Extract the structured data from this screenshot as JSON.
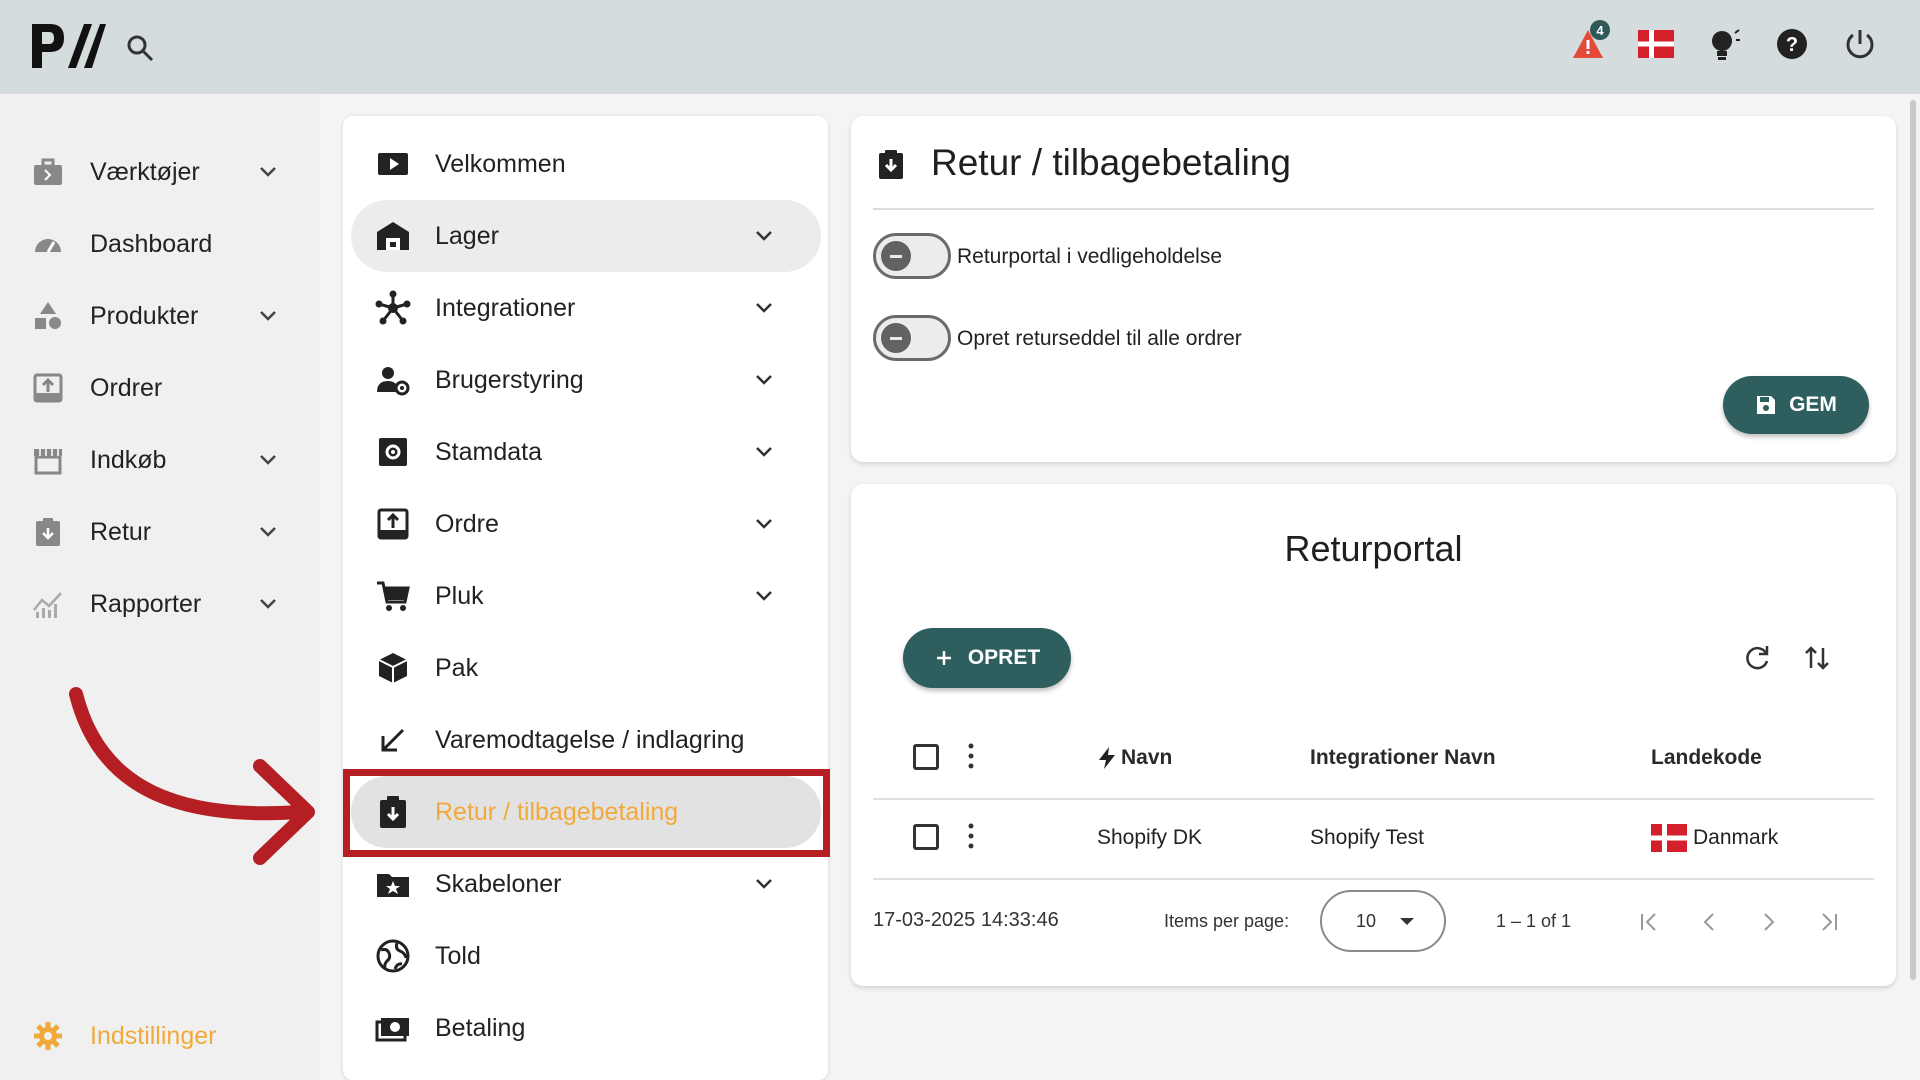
{
  "topbar": {
    "logo_text": "P//",
    "notification_count": "4",
    "icons": [
      "search-icon",
      "alert-icon",
      "denmark-flag-icon",
      "lightbulb-icon",
      "help-icon",
      "power-icon"
    ]
  },
  "sidebar": {
    "items": [
      {
        "label": "Værktøjer",
        "icon": "tools-icon",
        "expandable": true
      },
      {
        "label": "Dashboard",
        "icon": "dashboard-icon",
        "expandable": false
      },
      {
        "label": "Produkter",
        "icon": "products-icon",
        "expandable": true
      },
      {
        "label": "Ordrer",
        "icon": "orders-icon",
        "expandable": false
      },
      {
        "label": "Indkøb",
        "icon": "purchase-icon",
        "expandable": true
      },
      {
        "label": "Retur",
        "icon": "return-icon",
        "expandable": true
      },
      {
        "label": "Rapporter",
        "icon": "reports-icon",
        "expandable": true
      }
    ],
    "settings_label": "Indstillinger"
  },
  "settings_menu": {
    "items": [
      {
        "label": "Velkommen",
        "icon": "play-icon",
        "expandable": false
      },
      {
        "label": "Lager",
        "icon": "warehouse-icon",
        "expandable": true
      },
      {
        "label": "Integrationer",
        "icon": "integrations-icon",
        "expandable": true
      },
      {
        "label": "Brugerstyring",
        "icon": "user-management-icon",
        "expandable": true
      },
      {
        "label": "Stamdata",
        "icon": "master-data-icon",
        "expandable": true
      },
      {
        "label": "Ordre",
        "icon": "order-icon",
        "expandable": true
      },
      {
        "label": "Pluk",
        "icon": "cart-icon",
        "expandable": true
      },
      {
        "label": "Pak",
        "icon": "package-icon",
        "expandable": false
      },
      {
        "label": "Varemodtagelse / indlagring",
        "icon": "receive-arrow-icon",
        "expandable": false
      },
      {
        "label": "Retur / tilbagebetaling",
        "icon": "return-clipboard-icon",
        "expandable": false
      },
      {
        "label": "Skabeloner",
        "icon": "templates-icon",
        "expandable": true
      },
      {
        "label": "Told",
        "icon": "globe-icon",
        "expandable": false
      },
      {
        "label": "Betaling",
        "icon": "payment-icon",
        "expandable": false
      }
    ],
    "selected_index": 9
  },
  "retur_card": {
    "title": "Retur / tilbagebetaling",
    "toggles": [
      {
        "label": "Returportal i vedligeholdelse",
        "on": false
      },
      {
        "label": "Opret returseddel til alle ordrer",
        "on": false
      }
    ],
    "save_label": "GEM"
  },
  "portal_card": {
    "title": "Returportal",
    "create_label": "OPRET",
    "columns": [
      "Navn",
      "Integrationer Navn",
      "Landekode"
    ],
    "rows": [
      {
        "navn": "Shopify DK",
        "integration": "Shopify Test",
        "landekode": "Danmark"
      }
    ],
    "timestamp": "17-03-2025 14:33:46",
    "items_per_page_label": "Items per page:",
    "items_per_page": "10",
    "range": "1 – 1 of 1"
  },
  "colors": {
    "accent": "#2f5e5e",
    "highlight": "#f2a93b",
    "annotation": "#b51f24",
    "topbar": "#d4dcdd"
  }
}
